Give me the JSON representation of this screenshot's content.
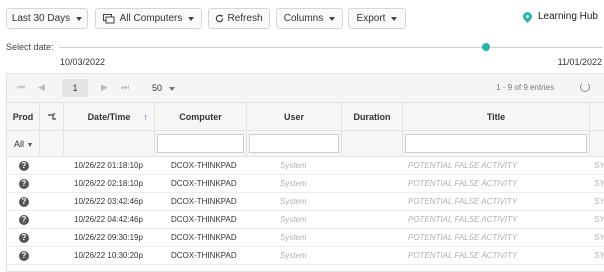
{
  "toolbar": {
    "range_label": "Last 30 Days",
    "computers_label": "All Computers",
    "refresh_label": "Refresh",
    "columns_label": "Columns",
    "export_label": "Export",
    "learning_hub_label": "Learning Hub"
  },
  "date_selector": {
    "label": "Select date:",
    "start_date": "10/03/2022",
    "end_date": "11/01/2022",
    "selected_fraction": 0.78
  },
  "pager": {
    "current_page": "1",
    "page_size": "50",
    "entries_text": "1 - 9 of 9 entries",
    "first_glyph": "⏮",
    "prev_glyph": "◀",
    "next_glyph": "▶",
    "last_glyph": "⏭"
  },
  "columns": {
    "prod": "Prod",
    "datetime": "Date/Time",
    "computer": "Computer",
    "user": "User",
    "duration": "Duration",
    "title": "Title"
  },
  "filter": {
    "prod_value": "All"
  },
  "rows": [
    {
      "datetime": "10/26/22 01:18:10p",
      "computer": "DCOX-THINKPAD",
      "user": "System",
      "title": "POTENTIAL FALSE ACTIVITY",
      "extra": "SY"
    },
    {
      "datetime": "10/26/22 02:18:10p",
      "computer": "DCOX-THINKPAD",
      "user": "System",
      "title": "POTENTIAL FALSE ACTIVITY",
      "extra": "SY"
    },
    {
      "datetime": "10/26/22 03:42:46p",
      "computer": "DCOX-THINKPAD",
      "user": "System",
      "title": "POTENTIAL FALSE ACTIVITY",
      "extra": "SY"
    },
    {
      "datetime": "10/26/22 04:42:46p",
      "computer": "DCOX-THINKPAD",
      "user": "System",
      "title": "POTENTIAL FALSE ACTIVITY",
      "extra": "SY"
    },
    {
      "datetime": "10/26/22 09:30:19p",
      "computer": "DCOX-THINKPAD",
      "user": "System",
      "title": "POTENTIAL FALSE ACTIVITY",
      "extra": "SY"
    },
    {
      "datetime": "10/26/22 10:30:20p",
      "computer": "DCOX-THINKPAD",
      "user": "System",
      "title": "POTENTIAL FALSE ACTIVITY",
      "extra": "SY"
    }
  ],
  "colors": {
    "accent": "#21b8a5",
    "header_bg": "#f6f6f6",
    "muted_text": "#b0b0b0"
  }
}
